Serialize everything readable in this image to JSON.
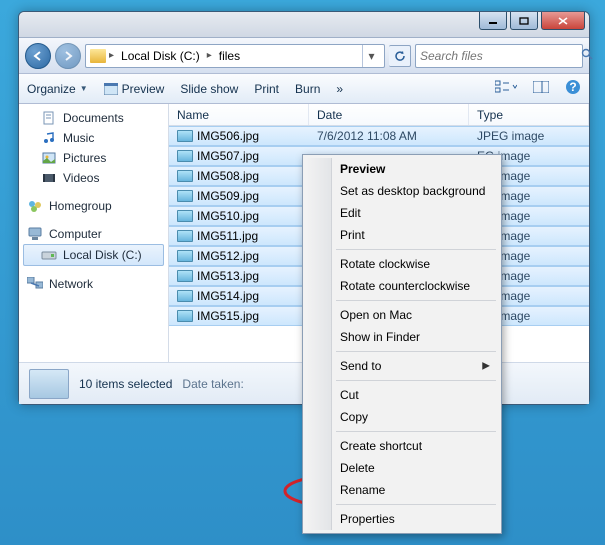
{
  "breadcrumb": {
    "segments": [
      "Local Disk (C:)",
      "files"
    ]
  },
  "search": {
    "placeholder": "Search files"
  },
  "toolbar": {
    "organize": "Organize",
    "preview": "Preview",
    "slideshow": "Slide show",
    "print": "Print",
    "burn": "Burn",
    "overflow": "»"
  },
  "sidebar": {
    "documents": "Documents",
    "music": "Music",
    "pictures": "Pictures",
    "videos": "Videos",
    "homegroup": "Homegroup",
    "computer": "Computer",
    "localdisk": "Local Disk (C:)",
    "network": "Network"
  },
  "columns": {
    "name": "Name",
    "date": "Date",
    "type": "Type"
  },
  "files": [
    {
      "name": "IMG506.jpg",
      "date": "7/6/2012 11:08 AM",
      "type": "JPEG image"
    },
    {
      "name": "IMG507.jpg",
      "date": "",
      "type": "EG image"
    },
    {
      "name": "IMG508.jpg",
      "date": "",
      "type": "EG image"
    },
    {
      "name": "IMG509.jpg",
      "date": "",
      "type": "EG image"
    },
    {
      "name": "IMG510.jpg",
      "date": "",
      "type": "EG image"
    },
    {
      "name": "IMG511.jpg",
      "date": "",
      "type": "EG image"
    },
    {
      "name": "IMG512.jpg",
      "date": "",
      "type": "EG image"
    },
    {
      "name": "IMG513.jpg",
      "date": "",
      "type": "EG image"
    },
    {
      "name": "IMG514.jpg",
      "date": "",
      "type": "EG image"
    },
    {
      "name": "IMG515.jpg",
      "date": "",
      "type": "EG image"
    }
  ],
  "status": {
    "main": "10 items selected",
    "sub_label": "Date taken:"
  },
  "context": {
    "preview": "Preview",
    "setbg": "Set as desktop background",
    "edit": "Edit",
    "print": "Print",
    "rotcw": "Rotate clockwise",
    "rotccw": "Rotate counterclockwise",
    "openmac": "Open on Mac",
    "showfinder": "Show in Finder",
    "sendto": "Send to",
    "cut": "Cut",
    "copy": "Copy",
    "shortcut": "Create shortcut",
    "delete": "Delete",
    "rename": "Rename",
    "properties": "Properties"
  }
}
